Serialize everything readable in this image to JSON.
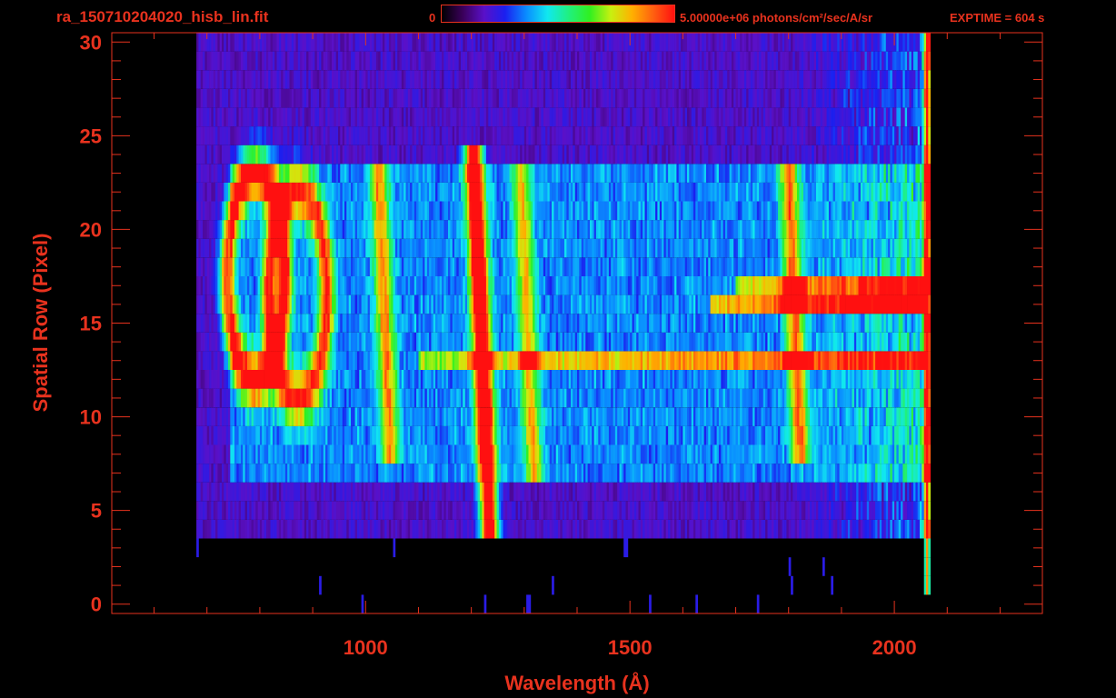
{
  "header": {
    "title": "ra_150710204020_hisb_lin.fit",
    "colorbar_min": "0",
    "colorbar_max": "5.00000e+06 photons/cm²/sec/A/sr",
    "exptime": "EXPTIME = 604 s"
  },
  "colors": {
    "accent": "#e8321e",
    "colormap": [
      "#000000",
      "#3a005a",
      "#5a10c8",
      "#1a20f0",
      "#0a8cff",
      "#10e8f0",
      "#20f080",
      "#30f020",
      "#c8f010",
      "#ffb000",
      "#ff6010",
      "#ff1010"
    ]
  },
  "chart_data": {
    "type": "heatmap",
    "title": "ra_150710204020_hisb_lin.fit",
    "xlabel": "Wavelength (Å)",
    "ylabel": "Spatial Row (Pixel)",
    "xlim": [
      520,
      2280
    ],
    "ylim": [
      -0.5,
      30.5
    ],
    "xticks": [
      1000,
      1500,
      2000
    ],
    "yticks": [
      0,
      5,
      10,
      15,
      20,
      25,
      30
    ],
    "x_tick_labels": [
      "1000",
      "1500",
      "2000"
    ],
    "y_tick_labels": [
      "0",
      "5",
      "10",
      "15",
      "20",
      "25",
      "30"
    ],
    "colorbar_range": [
      0,
      5000000
    ],
    "colorbar_unit": "photons/cm²/sec/A/sr",
    "grid": false,
    "features": [
      {
        "kind": "emission_line",
        "wavelength": 1216,
        "rows": [
          4,
          24
        ],
        "peak_level": 0.95
      },
      {
        "kind": "emission_line",
        "wavelength": 1035,
        "rows": [
          8,
          23
        ],
        "peak_level": 0.5
      },
      {
        "kind": "emission_line",
        "wavelength": 1304,
        "rows": [
          7,
          23
        ],
        "peak_level": 0.45
      },
      {
        "kind": "emission_line",
        "wavelength": 1810,
        "rows": [
          8,
          23
        ],
        "peak_level": 0.55
      },
      {
        "kind": "ring",
        "wavelength_center": 790,
        "row_center": 17.5,
        "peak_level": 0.75
      },
      {
        "kind": "ring",
        "wavelength_center": 870,
        "row_center": 16.5,
        "peak_level": 0.65
      },
      {
        "kind": "band",
        "row": 13,
        "wavelength_range": [
          1100,
          2060
        ],
        "peak_level": 0.55
      },
      {
        "kind": "band",
        "row": 16,
        "wavelength_range": [
          1650,
          2060
        ],
        "peak_level": 0.7
      },
      {
        "kind": "band",
        "row": 17,
        "wavelength_range": [
          1700,
          2060
        ],
        "peak_level": 0.6
      },
      {
        "kind": "cutoff",
        "wavelength": 2060,
        "rows": [
          1,
          30
        ],
        "peak_level": 0.85
      }
    ]
  }
}
